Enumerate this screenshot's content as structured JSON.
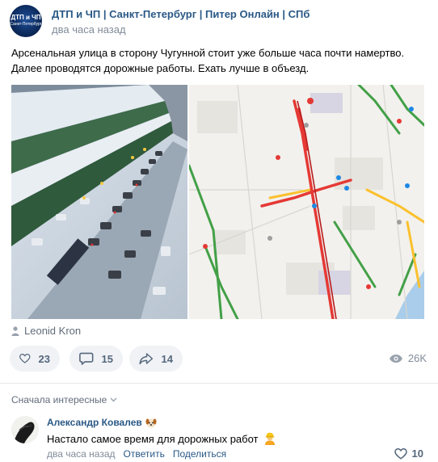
{
  "post": {
    "group_name": "ДТП и ЧП | Санкт-Петербург | Питер Онлайн | СПб",
    "avatar_text_top": "ДТП и ЧП",
    "avatar_text_bottom": "Санкт-Петербург",
    "time": "два часа назад",
    "text": "Арсенальная улица в сторону Чугунной стоит уже больше часа почти намертво. Далее проводятся дорожные работы. Ехать лучше в объезд.",
    "author": "Leonid Kron"
  },
  "actions": {
    "likes": "23",
    "comments": "15",
    "shares": "14",
    "views": "26K"
  },
  "comments": {
    "sort_label": "Сначала интересные",
    "items": [
      {
        "author": "Александр Ковалев",
        "text": "Настало самое время для дорожных работ",
        "time": "два часа назад",
        "reply_label": "Ответить",
        "share_label": "Поделиться",
        "likes": "10"
      }
    ]
  },
  "colors": {
    "link": "#2a5885",
    "muted": "#818c99",
    "button_bg": "#f0f2f5",
    "traffic_red": "#e53935",
    "traffic_yellow": "#fbc02d",
    "traffic_green": "#43a047"
  }
}
